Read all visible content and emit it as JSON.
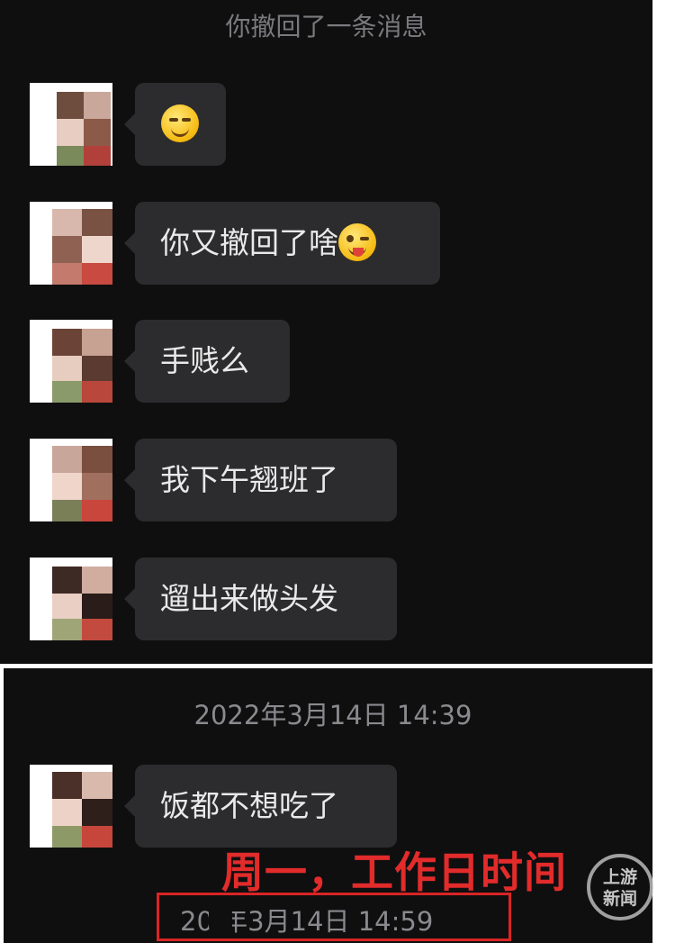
{
  "chat": {
    "recall_notice": "你撤回了一条消息",
    "messages": [
      {
        "text": "",
        "emoji": "grinning-face-emoji"
      },
      {
        "text": "你又撤回了啥",
        "emoji": "winking-tongue-face-emoji"
      },
      {
        "text": "手贱么"
      },
      {
        "text": "我下午翘班了"
      },
      {
        "text": "遛出来做头发"
      },
      {
        "text": "饭都不想吃了"
      }
    ],
    "timestamp_1": "2022年3月14日 14:39",
    "timestamp_2": "20  年3月14日 14:59"
  },
  "annotation": {
    "caption": "周一，工作日时间",
    "box_color": "#d92424"
  },
  "watermark": {
    "line1": "上游",
    "line2": "新闻"
  },
  "colors": {
    "background": "#0f0f10",
    "bubble": "#2c2c2e",
    "text": "#e9e9ea",
    "timestamp": "#8a8a8e",
    "caption": "#e22b2b"
  }
}
